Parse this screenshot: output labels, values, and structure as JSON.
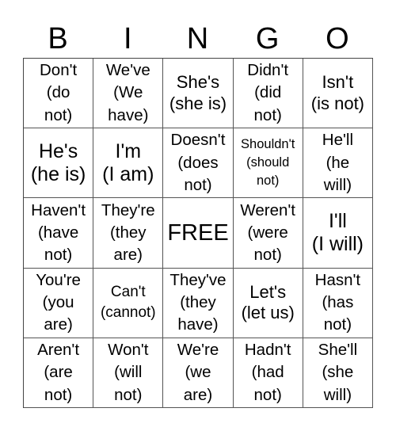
{
  "header": {
    "letters": [
      "B",
      "I",
      "N",
      "G",
      "O"
    ]
  },
  "card": {
    "cells": [
      {
        "text": "Don't\n(do\nnot)",
        "size": "fs-rg"
      },
      {
        "text": "We've\n(We\nhave)",
        "size": "fs-rg"
      },
      {
        "text": "She's\n(she is)",
        "size": "fs-md"
      },
      {
        "text": "Didn't\n(did\nnot)",
        "size": "fs-rg"
      },
      {
        "text": "Isn't\n(is not)",
        "size": "fs-md"
      },
      {
        "text": "He's\n(he is)",
        "size": "fs-lg"
      },
      {
        "text": "I'm\n(I am)",
        "size": "fs-lg"
      },
      {
        "text": "Doesn't\n(does\nnot)",
        "size": "fs-rg"
      },
      {
        "text": "Shouldn't\n(should\nnot)",
        "size": "fs-xs"
      },
      {
        "text": "He'll\n(he\nwill)",
        "size": "fs-rg"
      },
      {
        "text": "Haven't\n(have\nnot)",
        "size": "fs-rg"
      },
      {
        "text": "They're\n(they\nare)",
        "size": "fs-rg"
      },
      {
        "text": "FREE",
        "size": "fs-free"
      },
      {
        "text": "Weren't\n(were\nnot)",
        "size": "fs-rg"
      },
      {
        "text": "I'll\n(I will)",
        "size": "fs-lg"
      },
      {
        "text": "You're\n(you\nare)",
        "size": "fs-rg"
      },
      {
        "text": "Can't\n(cannot)",
        "size": "fs-sm"
      },
      {
        "text": "They've\n(they\nhave)",
        "size": "fs-rg"
      },
      {
        "text": "Let's\n(let us)",
        "size": "fs-md"
      },
      {
        "text": "Hasn't\n(has\nnot)",
        "size": "fs-rg"
      },
      {
        "text": "Aren't\n(are\nnot)",
        "size": "fs-rg"
      },
      {
        "text": "Won't\n(will\nnot)",
        "size": "fs-rg"
      },
      {
        "text": "We're\n(we\nare)",
        "size": "fs-rg"
      },
      {
        "text": "Hadn't\n(had\nnot)",
        "size": "fs-rg"
      },
      {
        "text": "She'll\n(she\nwill)",
        "size": "fs-rg"
      }
    ]
  }
}
